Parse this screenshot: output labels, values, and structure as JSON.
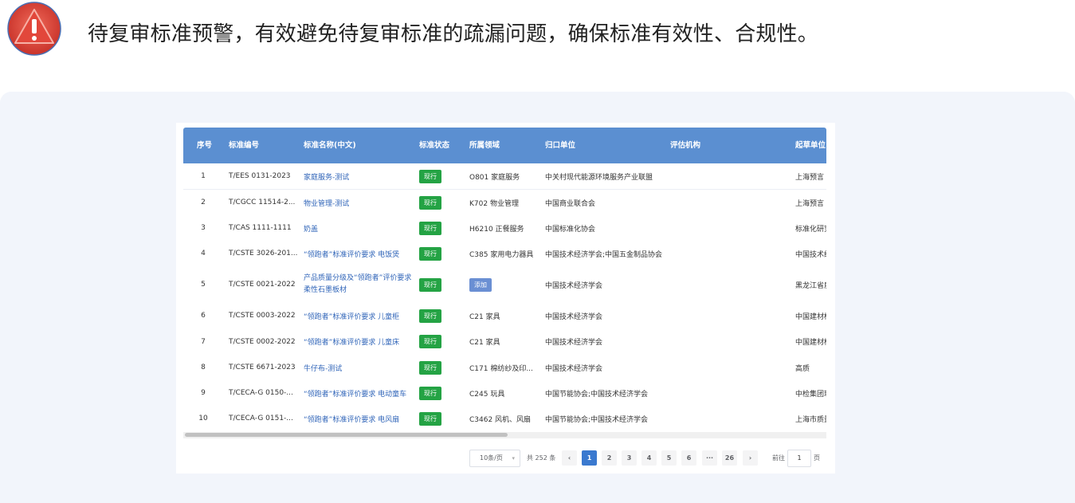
{
  "headline": "待复审标准预警，有效避免待复审标准的疏漏问题，确保标准有效性、合规性。",
  "colors": {
    "header": "#5b8fd1",
    "status_current": "#24a344",
    "status_add": "#6a8fd3",
    "link": "#2f64b8"
  },
  "table": {
    "headers": {
      "seq": "序号",
      "code": "标准编号",
      "name": "标准名称(中文)",
      "status": "标准状态",
      "field": "所属领域",
      "unit": "归口单位",
      "eval": "评估机构",
      "drafter": "起草单位"
    },
    "rows": [
      {
        "seq": "1",
        "code": "T/EES 0131-2023",
        "name": "家庭服务-测试",
        "status": "现行",
        "status_type": "green",
        "field": "O801 家庭服务",
        "unit": "中关村现代能源环境服务产业联盟",
        "eval": "",
        "drafter": "上海预言"
      },
      {
        "seq": "2",
        "code": "T/CGCC 11514-2...",
        "name": "物业管理-测试",
        "status": "现行",
        "status_type": "green",
        "field": "K702 物业管理",
        "unit": "中国商业联合会",
        "eval": "",
        "drafter": "上海预言"
      },
      {
        "seq": "3",
        "code": "T/CAS 1111-1111",
        "name": "奶盖",
        "status": "现行",
        "status_type": "green",
        "field": "H6210 正餐服务",
        "unit": "中国标准化协会",
        "eval": "",
        "drafter": "标准化研究"
      },
      {
        "seq": "4",
        "code": "T/CSTE 3026-201...",
        "name": "“领跑者”标准评价要求 电饭煲",
        "status": "现行",
        "status_type": "green",
        "field": "C385 家用电力器具",
        "unit": "中国技术经济学会;中国五金制品协会",
        "eval": "",
        "drafter": "中国技术经济"
      },
      {
        "seq": "5",
        "code": "T/CSTE 0021-2022",
        "name": "产品质量分级及“领跑者”评价要求 柔性石墨板材",
        "status": "现行",
        "status_type": "green",
        "field": "添加",
        "field_is_button": true,
        "unit": "中国技术经济学会",
        "eval": "",
        "drafter": "黑龙江省质"
      },
      {
        "seq": "6",
        "code": "T/CSTE 0003-2022",
        "name": "“领跑者”标准评价要求 儿童柜",
        "status": "现行",
        "status_type": "green",
        "field": "C21 家具",
        "unit": "中国技术经济学会",
        "eval": "",
        "drafter": "中国建材检"
      },
      {
        "seq": "7",
        "code": "T/CSTE 0002-2022",
        "name": "“领跑者”标准评价要求 儿童床",
        "status": "现行",
        "status_type": "green",
        "field": "C21 家具",
        "unit": "中国技术经济学会",
        "eval": "",
        "drafter": "中国建材检"
      },
      {
        "seq": "8",
        "code": "T/CSTE 6671-2023",
        "name": "牛仔布-测试",
        "status": "现行",
        "status_type": "green",
        "field": "C171 棉纺纱及印...",
        "unit": "中国技术经济学会",
        "eval": "",
        "drafter": "高质"
      },
      {
        "seq": "9",
        "code": "T/CECA-G 0150-...",
        "name": "“领跑者”标准评价要求 电动童车",
        "status": "现行",
        "status_type": "green",
        "field": "C245 玩具",
        "unit": "中国节能协会;中国技术经济学会",
        "eval": "",
        "drafter": "中检集团玩"
      },
      {
        "seq": "10",
        "code": "T/CECA-G 0151-...",
        "name": "“领跑者”标准评价要求 电风扇",
        "status": "现行",
        "status_type": "green",
        "field": "C3462 风机、风扇",
        "unit": "中国节能协会;中国技术经济学会",
        "eval": "",
        "drafter": "上海市质量"
      }
    ]
  },
  "pagination": {
    "page_size": "10条/页",
    "total": "共 252 条",
    "prev_icon": "‹",
    "next_icon": "›",
    "pages": [
      "1",
      "2",
      "3",
      "4",
      "5",
      "6",
      "···",
      "26"
    ],
    "current": "1",
    "goto_label": "前往",
    "goto_value": "1",
    "goto_unit": "页"
  }
}
